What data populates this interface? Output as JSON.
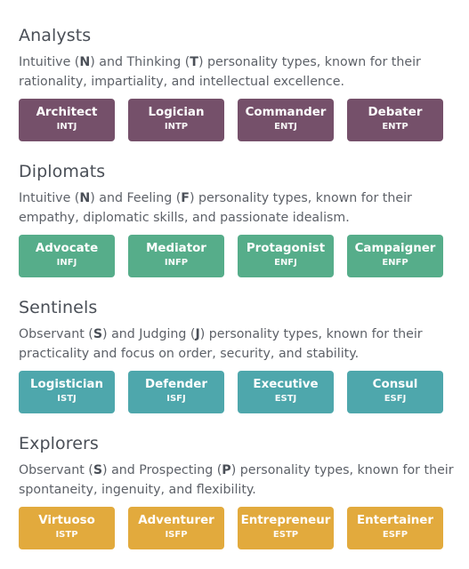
{
  "groups": [
    {
      "title": "Analysts",
      "desc_parts": [
        "Intuitive (",
        "N",
        ") and Thinking (",
        "T",
        ") personality types, known for their rationality, impartiality, and intellectual excellence."
      ],
      "color": "#75506a",
      "cards": [
        {
          "name": "Architect",
          "code": "INTJ"
        },
        {
          "name": "Logician",
          "code": "INTP"
        },
        {
          "name": "Commander",
          "code": "ENTJ"
        },
        {
          "name": "Debater",
          "code": "ENTP"
        }
      ]
    },
    {
      "title": "Diplomats",
      "desc_parts": [
        "Intuitive (",
        "N",
        ") and Feeling (",
        "F",
        ") personality types, known for their empathy, diplomatic skills, and passionate idealism."
      ],
      "color": "#56ad8a",
      "cards": [
        {
          "name": "Advocate",
          "code": "INFJ"
        },
        {
          "name": "Mediator",
          "code": "INFP"
        },
        {
          "name": "Protagonist",
          "code": "ENFJ"
        },
        {
          "name": "Campaigner",
          "code": "ENFP"
        }
      ]
    },
    {
      "title": "Sentinels",
      "desc_parts": [
        "Observant (",
        "S",
        ") and Judging (",
        "J",
        ") personality types, known for their practicality and focus on order, security, and stability."
      ],
      "color": "#4ea7ac",
      "cards": [
        {
          "name": "Logistician",
          "code": "ISTJ"
        },
        {
          "name": "Defender",
          "code": "ISFJ"
        },
        {
          "name": "Executive",
          "code": "ESTJ"
        },
        {
          "name": "Consul",
          "code": "ESFJ"
        }
      ]
    },
    {
      "title": "Explorers",
      "desc_parts": [
        "Observant (",
        "S",
        ") and Prospecting (",
        "P",
        ") personality types, known for their spontaneity, ingenuity, and flexibility."
      ],
      "color": "#e2aa3d",
      "cards": [
        {
          "name": "Virtuoso",
          "code": "ISTP"
        },
        {
          "name": "Adventurer",
          "code": "ISFP"
        },
        {
          "name": "Entrepreneur",
          "code": "ESTP"
        },
        {
          "name": "Entertainer",
          "code": "ESFP"
        }
      ]
    }
  ]
}
